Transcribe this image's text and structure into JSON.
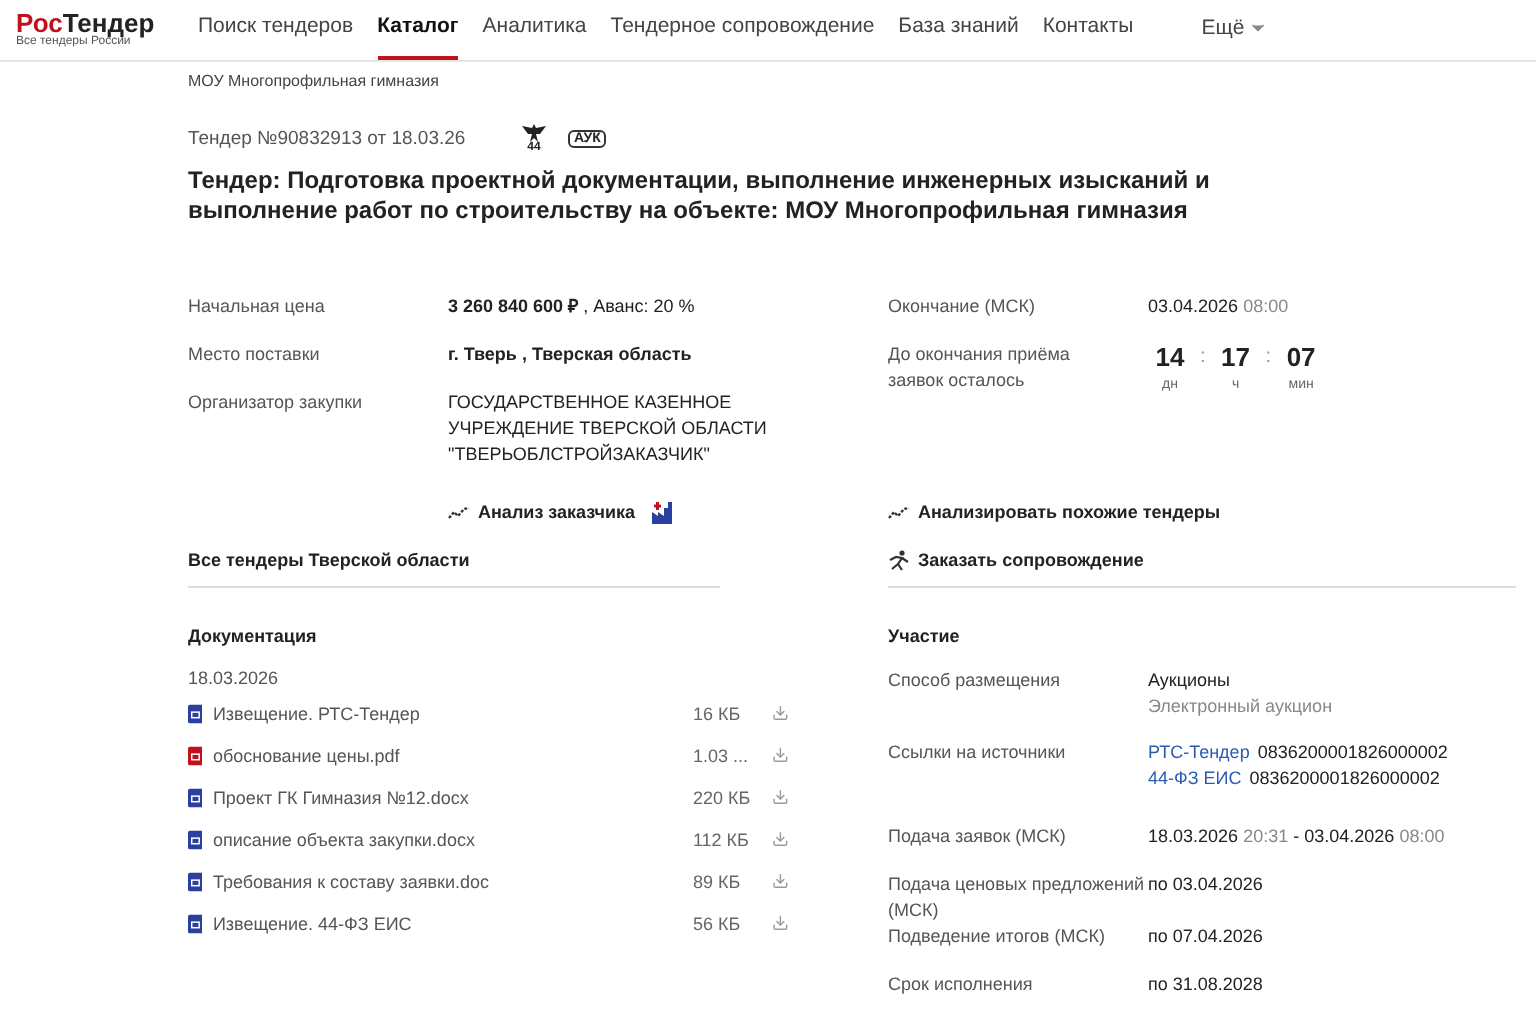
{
  "logo": {
    "part1": "Рос",
    "part2": "Тендер",
    "tagline": "Все тендеры России"
  },
  "nav": [
    {
      "label": "Поиск тендеров",
      "selected": false
    },
    {
      "label": "Каталог",
      "selected": true
    },
    {
      "label": "Аналитика",
      "selected": false
    },
    {
      "label": "Тендерное сопровождение",
      "selected": false
    },
    {
      "label": "База знаний",
      "selected": false
    },
    {
      "label": "Контакты",
      "selected": false
    }
  ],
  "nav_more": "Ещё",
  "breadcrumb": "МОУ Многопрофильная гимназия",
  "tender": {
    "number": "Тендер  №90832913 от 18.03.26",
    "law": "44",
    "type_badge": "АУК"
  },
  "title": "Тендер: Подготовка проектной документации, выполнение инженерных изысканий и выполнение работ по строительству на объекте: МОУ Многопрофильная гимназия",
  "details": [
    {
      "label": "Начальная цена",
      "value": "**3 260 840 600 ₽** , Аванс:  20 %",
      "bold": false
    },
    {
      "label": "Место поставки",
      "value": "г. Тверь , Тверская область",
      "bold": true
    },
    {
      "label": "Организатор закупки",
      "value": "ГОСУДАРСТВЕННОЕ КАЗЕННОЕ УЧРЕЖДЕНИЕ ТВЕРСКОЙ ОБЛАСТИ \"ТВЕРЬОБЛСТРОЙЗАКАЗЧИК\"",
      "bold": false
    }
  ],
  "customer_analysis": "Анализ заказчика",
  "region_link": "Все тендеры Тверской области",
  "deadline": {
    "label": "Окончание (МСК)",
    "date": "03.04.2026",
    "time": "08:00"
  },
  "countdown": {
    "label": "До окончания приёма заявок осталось",
    "separator": ":",
    "parts": [
      {
        "value": "14",
        "unit": "дн"
      },
      {
        "value": "17",
        "unit": "ч"
      },
      {
        "value": "07",
        "unit": "мин"
      }
    ]
  },
  "actions": [
    {
      "kind": "chart",
      "label": "Анализировать похожие тендеры"
    },
    {
      "kind": "support",
      "label": "Заказать сопровождение"
    }
  ],
  "documents": {
    "title": "Документация",
    "date": "18.03.2026",
    "files": [
      {
        "name": "Извещение. РТС-Тендер",
        "size": "16 КБ",
        "kind": "doc"
      },
      {
        "name": "обоснование цены.pdf",
        "size": "1.03 ...",
        "kind": "pdf"
      },
      {
        "name": "Проект ГК Гимназия №12.docx",
        "size": "220 КБ",
        "kind": "doc"
      },
      {
        "name": "описание объекта закупки.docx",
        "size": "112 КБ",
        "kind": "doc"
      },
      {
        "name": "Требования к составу заявки.doc",
        "size": "89 КБ",
        "kind": "doc"
      },
      {
        "name": "Извещение. 44-ФЗ ЕИС",
        "size": "56 КБ",
        "kind": "doc"
      }
    ]
  },
  "participation": {
    "title": "Участие",
    "rows": [
      {
        "kind": "method",
        "label": "Способ размещения",
        "value": "Аукционы",
        "sub": "Электронный аукцион"
      },
      {
        "kind": "links",
        "label": "Ссылки на источники",
        "links": [
          {
            "source": "РТС-Тендер",
            "number": "0836200001826000002"
          },
          {
            "source": "44-ФЗ ЕИС",
            "number": "0836200001826000002"
          }
        ]
      },
      {
        "kind": "range",
        "label": "Подача заявок (МСК)",
        "start_date": "18.03.2026",
        "start_time": "20:31",
        "separator": "-",
        "end_date": "03.04.2026",
        "end_time": "08:00"
      },
      {
        "kind": "plain",
        "label": "Подача ценовых предложений (МСК)",
        "value": "по 03.04.2026"
      },
      {
        "kind": "plain",
        "label": "Подведение итогов (МСК)",
        "value": "по 07.04.2026"
      },
      {
        "kind": "plain",
        "label": "Срок исполнения",
        "value": "по 31.08.2028"
      }
    ]
  }
}
